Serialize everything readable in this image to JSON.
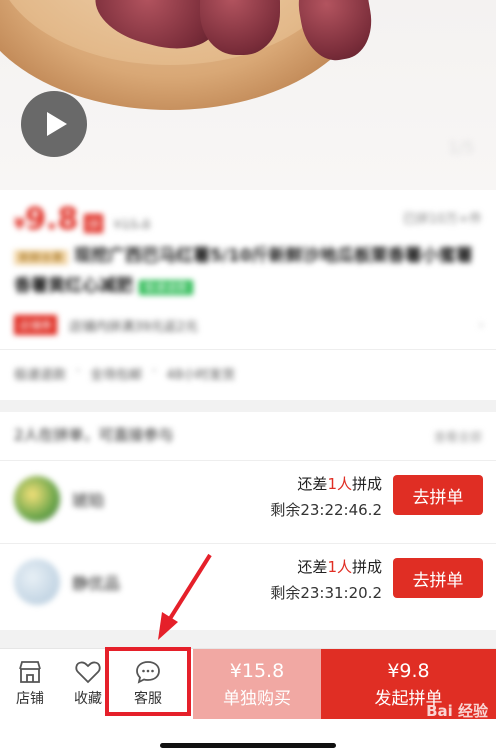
{
  "hero": {
    "play_icon": "play-icon",
    "image_counter": "1/5"
  },
  "product": {
    "price_symbol": "¥",
    "price": "9.8",
    "price_tag": "拼",
    "original_price": "¥15.8",
    "sold": "已拼10万+件",
    "badge": "新鲜水果",
    "title": "现挖广西巴马红薯5/10斤新鲜沙地瓜板栗香薯小蜜薯香薯黄红心减肥",
    "green_badge": "极速退款",
    "promo_tag": "店铺券",
    "promo_text": "店铺内拼满39元返2元",
    "services": [
      "极速退款",
      "全场包邮",
      "48小时发货"
    ]
  },
  "group": {
    "header": "2人在拼单，可直接参与",
    "more": "查看全部",
    "rows": [
      {
        "name": "琥珀",
        "need_prefix": "还差",
        "need_count": "1人",
        "need_suffix": "拼成",
        "remain": "剩余23:22:46.2",
        "button": "去拼单"
      },
      {
        "name": "静优品",
        "need_prefix": "还差",
        "need_count": "1人",
        "need_suffix": "拼成",
        "remain": "剩余23:31:20.2",
        "button": "去拼单"
      }
    ]
  },
  "bottom_bar": {
    "store_label": "店铺",
    "favorite_label": "收藏",
    "service_label": "客服",
    "single_price": "¥15.8",
    "single_label": "单独购买",
    "group_price": "¥9.8",
    "group_label": "发起拼单"
  },
  "watermark": "Bai 经验",
  "colors": {
    "accent": "#e02e24",
    "light_accent": "#f1a8a3",
    "highlight": "#e5202a"
  }
}
